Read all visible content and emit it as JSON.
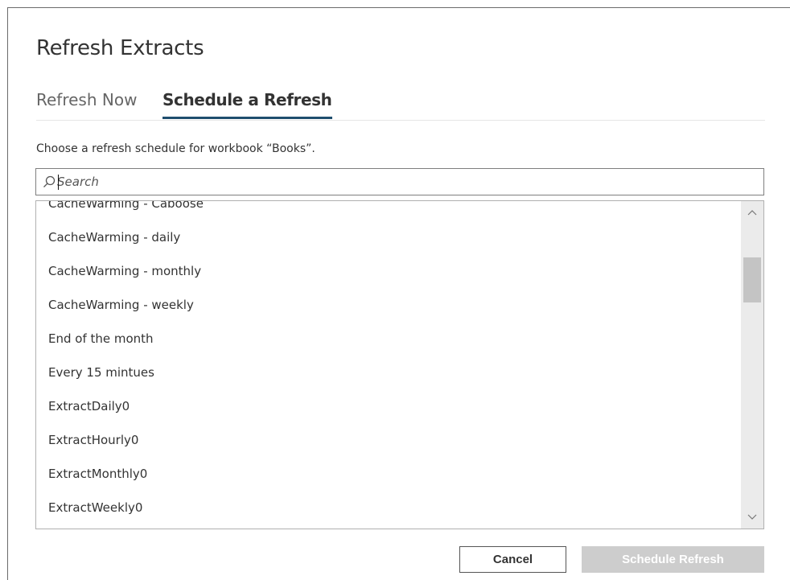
{
  "dialog": {
    "title": "Refresh Extracts",
    "tabs": [
      {
        "label": "Refresh Now",
        "active": false
      },
      {
        "label": "Schedule a Refresh",
        "active": true
      }
    ],
    "instruction": "Choose a refresh schedule for workbook “Books”.",
    "search": {
      "placeholder": "Search",
      "value": ""
    },
    "schedules": [
      "CacheWarming - Caboose",
      "CacheWarming - daily",
      "CacheWarming - monthly",
      "CacheWarming - weekly",
      "End of the month",
      "Every 15 mintues",
      "ExtractDaily0",
      "ExtractHourly0",
      "ExtractMonthly0",
      "ExtractWeekly0"
    ],
    "buttons": {
      "cancel": "Cancel",
      "schedule": "Schedule Refresh"
    }
  },
  "colors": {
    "active_tab_underline": "#1f4e6e",
    "disabled_button_bg": "#cdcdcd",
    "scroll_thumb": "#c4c4c4"
  },
  "icons": {
    "search": "search-icon",
    "scroll_up": "chevron-up-icon",
    "scroll_down": "chevron-down-icon"
  }
}
